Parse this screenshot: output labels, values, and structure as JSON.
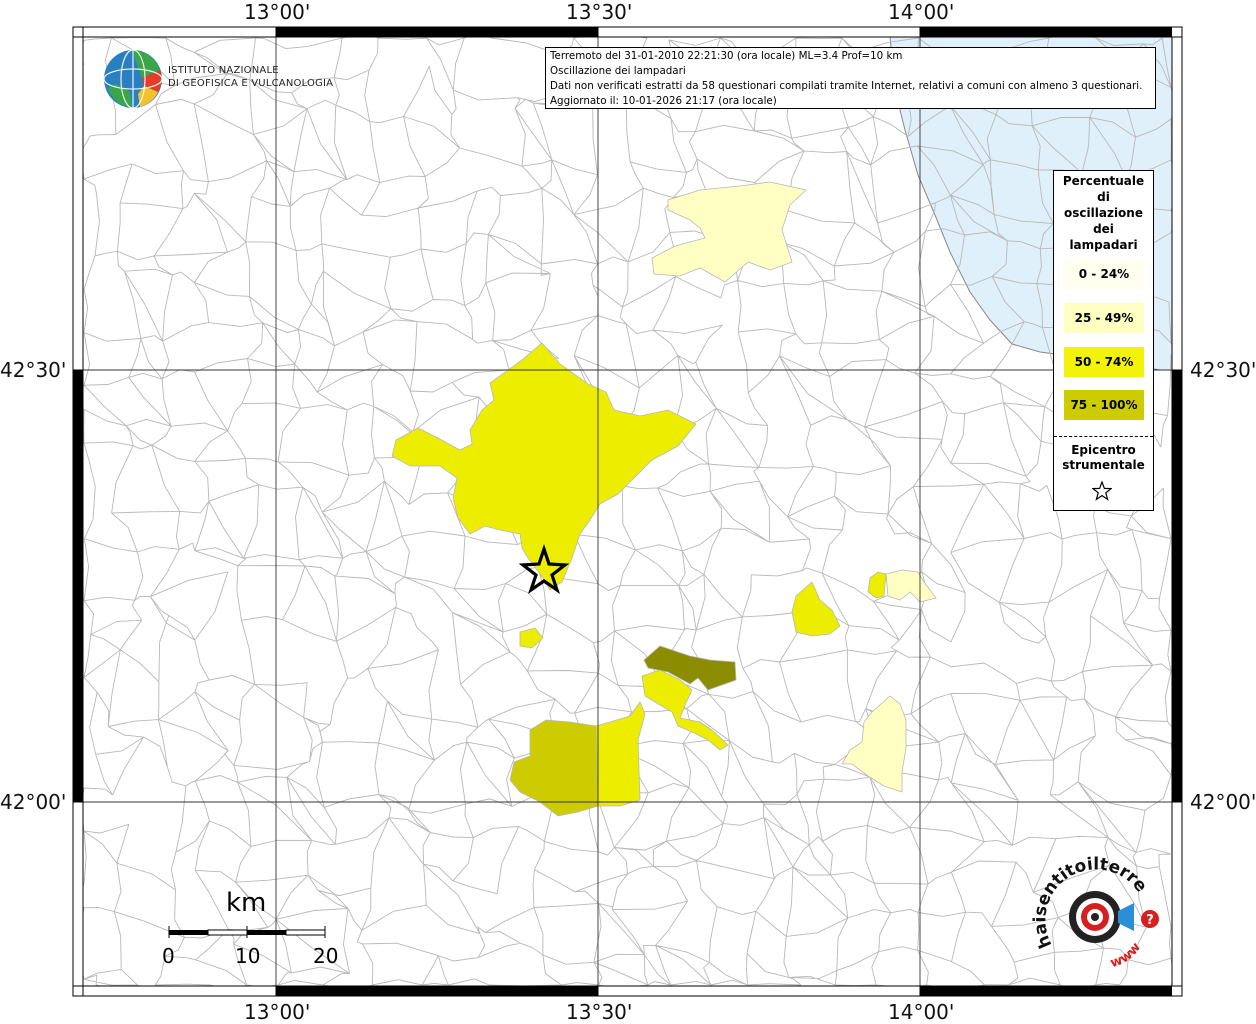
{
  "map": {
    "top_ticks": [
      "13°00'",
      "13°30'",
      "14°00'"
    ],
    "bottom_ticks": [
      "13°00'",
      "13°30'",
      "14°00'"
    ],
    "left_ticks": [
      "42°30'",
      "42°00'"
    ],
    "right_ticks": [
      "42°30'",
      "42°00'"
    ],
    "sea_color": "#dff0fb",
    "frame_color": "#000000"
  },
  "title_box": {
    "line1": "Terremoto del 31-01-2010 22:21:30 (ora locale) ML=3.4 Prof=10 km",
    "line2": "Oscillazione dei lampadari",
    "line3": "Dati non verificati estratti da 58 questionari compilati tramite Internet, relativi a comuni con almeno 3 questionari.",
    "line4": "Aggiornato il: 10-01-2026 21:17 (ora locale)"
  },
  "logo": {
    "name": "ingv-globe-icon",
    "line1": "ISTITUTO NAZIONALE",
    "line2": "DI GEOFISICA E VULCANOLOGIA"
  },
  "legend": {
    "title_lines": [
      "Percentuale",
      "di",
      "oscillazione",
      "dei",
      "lampadari"
    ],
    "classes": [
      {
        "label": "0 - 24%",
        "color": "#fffff0"
      },
      {
        "label": "25 - 49%",
        "color": "#ffffc4"
      },
      {
        "label": "50 - 74%",
        "color": "#f2f20a"
      },
      {
        "label": "75 - 100%",
        "color": "#cccc00"
      }
    ],
    "epicenter_lines": [
      "Epicentro",
      "strumentale"
    ],
    "epicenter_icon": "star-outline-icon"
  },
  "scale": {
    "unit": "km",
    "labels": [
      "0",
      "10",
      "20"
    ]
  },
  "badge": {
    "text_top": "haisentitoilterremoto.it",
    "text_bottom": "www",
    "icon": "megaphone-target-icon",
    "question": "?"
  }
}
